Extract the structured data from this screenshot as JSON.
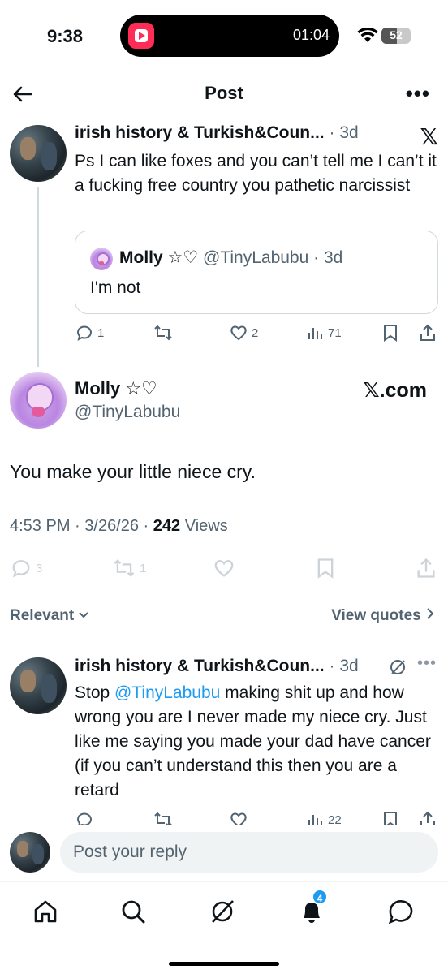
{
  "status_bar": {
    "time": "9:38",
    "timer": "01:04",
    "battery": "52",
    "battery_level": 0.52
  },
  "header": {
    "title": "Post"
  },
  "parent_tweet": {
    "author_name": "irish history & Turkish&Coun...",
    "time": "3d",
    "text": "Ps I can like foxes and you can’t tell me I can’t it a fucking free country you pathetic narcissist",
    "quote": {
      "author_name": "Molly ☆♡",
      "handle": "@TinyLabubu",
      "time": "3d",
      "text": "I'm not"
    },
    "actions": {
      "replies": "1",
      "retweets": "",
      "likes": "2",
      "views": "71"
    }
  },
  "main_tweet": {
    "author_name": "Molly ☆♡",
    "handle": "@TinyLabubu",
    "watermark": "𝕏.com",
    "text": "You make your little niece cry.",
    "time": "4:53 PM",
    "date": "3/26/26",
    "views_count": "242",
    "views_label": "Views",
    "actions": {
      "replies": "3",
      "retweets": "1",
      "likes": ""
    }
  },
  "sort": {
    "relevant_label": "Relevant",
    "view_quotes_label": "View quotes"
  },
  "reply": {
    "author_name": "irish history & Turkish&Coun...",
    "time": "3d",
    "text_before": "Stop ",
    "mention": "@TinyLabubu",
    "text_after": "  making shit up and how wrong you are I never made my niece cry. Just like me saying you made your dad have cancer (if you can’t understand this then you are a retard",
    "views": "22"
  },
  "reply_bar": {
    "placeholder": "Post your reply"
  },
  "bottom_nav": {
    "notifications_badge": "4"
  }
}
